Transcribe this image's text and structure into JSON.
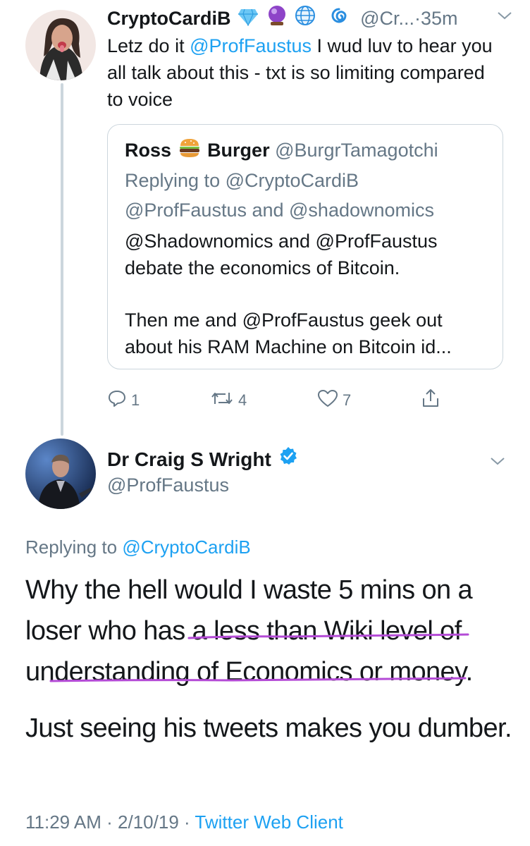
{
  "tweet1": {
    "display_name": "CryptoCardiB",
    "header_handle": "@Cr...",
    "separator": "·",
    "time": "35m",
    "text_prefix": "Letz do it ",
    "text_mention": "@ProfFaustus",
    "text_suffix": " I wud luv to hear you all talk about this - txt is so limiting compared to voice",
    "quote": {
      "first_name": "Ross",
      "last_name": "Burger",
      "handle": "@BurgrTamagotchi",
      "reply_label": "Replying to @CryptoCardiB",
      "reply_mentions": "@ProfFaustus and @shadownomics",
      "paragraph1": "@Shadownomics and @ProfFaustus debate the economics of Bitcoin.",
      "paragraph2": "Then me and @ProfFaustus geek out about his RAM Machine on Bitcoin id..."
    },
    "actions": {
      "replies": "1",
      "retweets": "4",
      "likes": "7"
    }
  },
  "tweet2": {
    "display_name": "Dr Craig S Wright",
    "handle": "@ProfFaustus",
    "replying_label": "Replying to ",
    "replying_to": "@CryptoCardiB",
    "paragraph1": "Why the hell would I waste 5 mins on a loser who has a less than Wiki level of understanding of Economics or money.",
    "paragraph2": "Just seeing his tweets makes you dumber.",
    "meta_time": "11:29 AM · 2/10/19 · ",
    "meta_client": "Twitter Web Client"
  },
  "colors": {
    "link": "#1da1f2",
    "muted": "#657786",
    "border": "#ccd6dd",
    "annotation": "#b44bd6"
  },
  "icons": [
    "diamond-icon",
    "crystal-ball-icon",
    "globe-icon",
    "cyclone-icon",
    "burger-icon",
    "verified-icon",
    "reply-icon",
    "retweet-icon",
    "like-icon",
    "share-icon",
    "chevron-down-icon"
  ]
}
